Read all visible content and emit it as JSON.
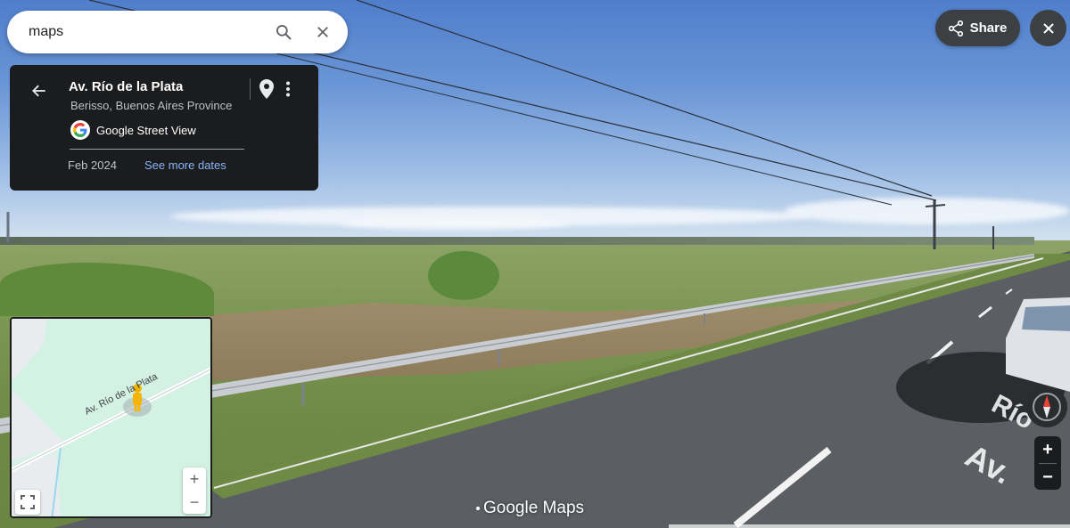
{
  "search": {
    "value": "maps",
    "search_icon": "search-icon",
    "clear_icon": "close-icon"
  },
  "info_card": {
    "title": "Av. Río de la Plata",
    "subtitle": "Berisso, Buenos Aires Province",
    "source_label": "Google Street View",
    "date": "Feb 2024",
    "more_dates_link": "See more dates",
    "icons": [
      "back-arrow-icon",
      "location-pin-icon",
      "more-vert-icon",
      "google-logo-icon"
    ]
  },
  "top_controls": {
    "share_label": "Share",
    "share_icon": "share-icon",
    "close_icon": "close-icon"
  },
  "minimap": {
    "road_label": "Av. Río de la Plata",
    "zoom_in": "+",
    "zoom_out": "−",
    "expand_icon": "fullscreen-icon"
  },
  "street_view_controls": {
    "zoom_in": "+",
    "zoom_out": "−",
    "compass_icon": "compass-icon"
  },
  "branding": {
    "logo_text": "Google Maps"
  },
  "road_marking_text": "Av. Río de la Plata",
  "colors": {
    "card_bg": "#1b1c1e",
    "link": "#8ab4f8",
    "button_bg": "#3c4043",
    "map_bg": "#d4f2e4"
  }
}
